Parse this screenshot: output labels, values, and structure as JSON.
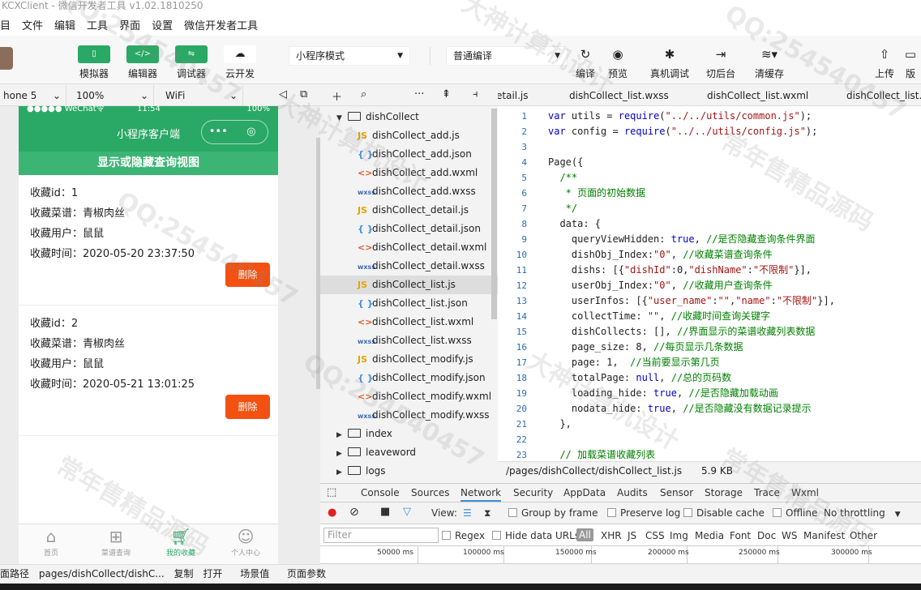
{
  "window": {
    "title": "KCXClient - 微信开发者工具 v1.02.1810250"
  },
  "menu": [
    "目",
    "文件",
    "编辑",
    "工具",
    "界面",
    "设置",
    "微信开发者工具"
  ],
  "toolbar": {
    "simulator": "模拟器",
    "editor": "编辑器",
    "debugger": "调试器",
    "cloud": "云开发",
    "mode_select": "小程序模式",
    "compile_select": "普通编译",
    "compile": "编译",
    "preview": "预览",
    "remote_debug": "真机调试",
    "background": "切后台",
    "clear_cache": "清缓存",
    "upload": "上传",
    "more": "版"
  },
  "sim": {
    "device": "hone 5",
    "zoom": "100%",
    "network": "WiFi"
  },
  "phone": {
    "status_left": "●●●●● WeChat令",
    "status_time": "11:54",
    "status_right": "100%",
    "nav_title": "小程序客户端",
    "toggle_label": "显示或隐藏查询视图",
    "records": [
      {
        "id": "收藏id：1",
        "dish": "收藏菜谱：青椒肉丝",
        "user": "收藏用户：鼠鼠",
        "time": "收藏时间：2020-05-20 23:37:50",
        "delete": "删除"
      },
      {
        "id": "收藏id：2",
        "dish": "收藏菜谱：青椒肉丝",
        "user": "收藏用户：鼠鼠",
        "time": "收藏时间：2020-05-21 13:01:25",
        "delete": "删除"
      }
    ],
    "tabs": [
      {
        "label": "首页",
        "icon": "home-icon"
      },
      {
        "label": "菜谱查询",
        "icon": "grid-icon"
      },
      {
        "label": "我的收藏",
        "icon": "cart-icon"
      },
      {
        "label": "个人中心",
        "icon": "person-icon"
      }
    ]
  },
  "pathbar": {
    "label": "面路径",
    "path": "pages/dishCollect/dishC...",
    "copy": "复制",
    "open": "打开",
    "scene": "场景值",
    "params": "页面参数"
  },
  "filetree": {
    "folder": "dishCollect",
    "files": [
      {
        "name": "dishCollect_add.js",
        "type": "js"
      },
      {
        "name": "dishCollect_add.json",
        "type": "json"
      },
      {
        "name": "dishCollect_add.wxml",
        "type": "wxml"
      },
      {
        "name": "dishCollect_add.wxss",
        "type": "wxss"
      },
      {
        "name": "dishCollect_detail.js",
        "type": "js"
      },
      {
        "name": "dishCollect_detail.json",
        "type": "json"
      },
      {
        "name": "dishCollect_detail.wxml",
        "type": "wxml"
      },
      {
        "name": "dishCollect_detail.wxss",
        "type": "wxss"
      },
      {
        "name": "dishCollect_list.js",
        "type": "js"
      },
      {
        "name": "dishCollect_list.json",
        "type": "json"
      },
      {
        "name": "dishCollect_list.wxml",
        "type": "wxml"
      },
      {
        "name": "dishCollect_list.wxss",
        "type": "wxss"
      },
      {
        "name": "dishCollect_modify.js",
        "type": "js"
      },
      {
        "name": "dishCollect_modify.json",
        "type": "json"
      },
      {
        "name": "dishCollect_modify.wxml",
        "type": "wxml"
      },
      {
        "name": "dishCollect_modify.wxss",
        "type": "wxss"
      }
    ],
    "folders": [
      "index",
      "leaveword",
      "logs"
    ],
    "file_icons": {
      "js": "JS",
      "json": "{ }",
      "wxml": "<>",
      "wxss": "wxss"
    }
  },
  "editor_tabs": [
    "etail.js",
    "dishCollect_list.wxss",
    "dishCollect_list.wxml",
    "dishCollect_list.j"
  ],
  "code": [
    "var utils = require(\"../../utils/common.js\");",
    "var config = require(\"../../utils/config.js\");",
    "",
    "Page({",
    "  /**",
    "   * 页面的初始数据",
    "   */",
    "  data: {",
    "    queryViewHidden: true, //是否隐藏查询条件界面",
    "    dishObj_Index:\"0\", //收藏菜谱查询条件",
    "    dishs: [{\"dishId\":0,\"dishName\":\"不限制\"}],",
    "    userObj_Index:\"0\", //收藏用户查询条件",
    "    userInfos: [{\"user_name\":\"\",\"name\":\"不限制\"}],",
    "    collectTime: \"\", //收藏时间查询关键字",
    "    dishCollects: [], //界面显示的菜谱收藏列表数据",
    "    page_size: 8, //每页显示几条数据",
    "    page: 1,  //当前要显示第几页",
    "    totalPage: null, //总的页码数",
    "    loading_hide: true, //是否隐藏加载动画",
    "    nodata_hide: true, //是否隐藏没有数据记录提示",
    "  },",
    "",
    "  // 加载菜谱收藏列表"
  ],
  "editor_status": {
    "path": "/pages/dishCollect/dishCollect_list.js",
    "size": "5.9 KB"
  },
  "devtools": {
    "tabs": [
      "Console",
      "Sources",
      "Network",
      "Security",
      "AppData",
      "Audits",
      "Sensor",
      "Storage",
      "Trace",
      "Wxml"
    ],
    "view": "View:",
    "group_by_frame": "Group by frame",
    "preserve_log": "Preserve log",
    "disable_cache": "Disable cache",
    "offline": "Offline",
    "throttling": "No throttling",
    "filter_placeholder": "Filter",
    "regex": "Regex",
    "hide_data_urls": "Hide data URLs",
    "types": [
      "All",
      "XHR",
      "JS",
      "CSS",
      "Img",
      "Media",
      "Font",
      "Doc",
      "WS",
      "Manifest",
      "Other"
    ],
    "ticks": [
      "50000 ms",
      "100000 ms",
      "150000 ms",
      "200000 ms",
      "250000 ms",
      "300000 ms"
    ]
  },
  "watermarks": [
    "QQ:254540457",
    "大神计算机设计",
    "常年售精品源码",
    "QQ:254540457",
    "大神计算机设计",
    "常年售精品源码",
    "QQ:254540457",
    "大神计算机设计",
    "常年售精品源码",
    "QQ:254540457"
  ],
  "colors": {
    "brand": "#2aa865",
    "danger": "#f35111"
  }
}
